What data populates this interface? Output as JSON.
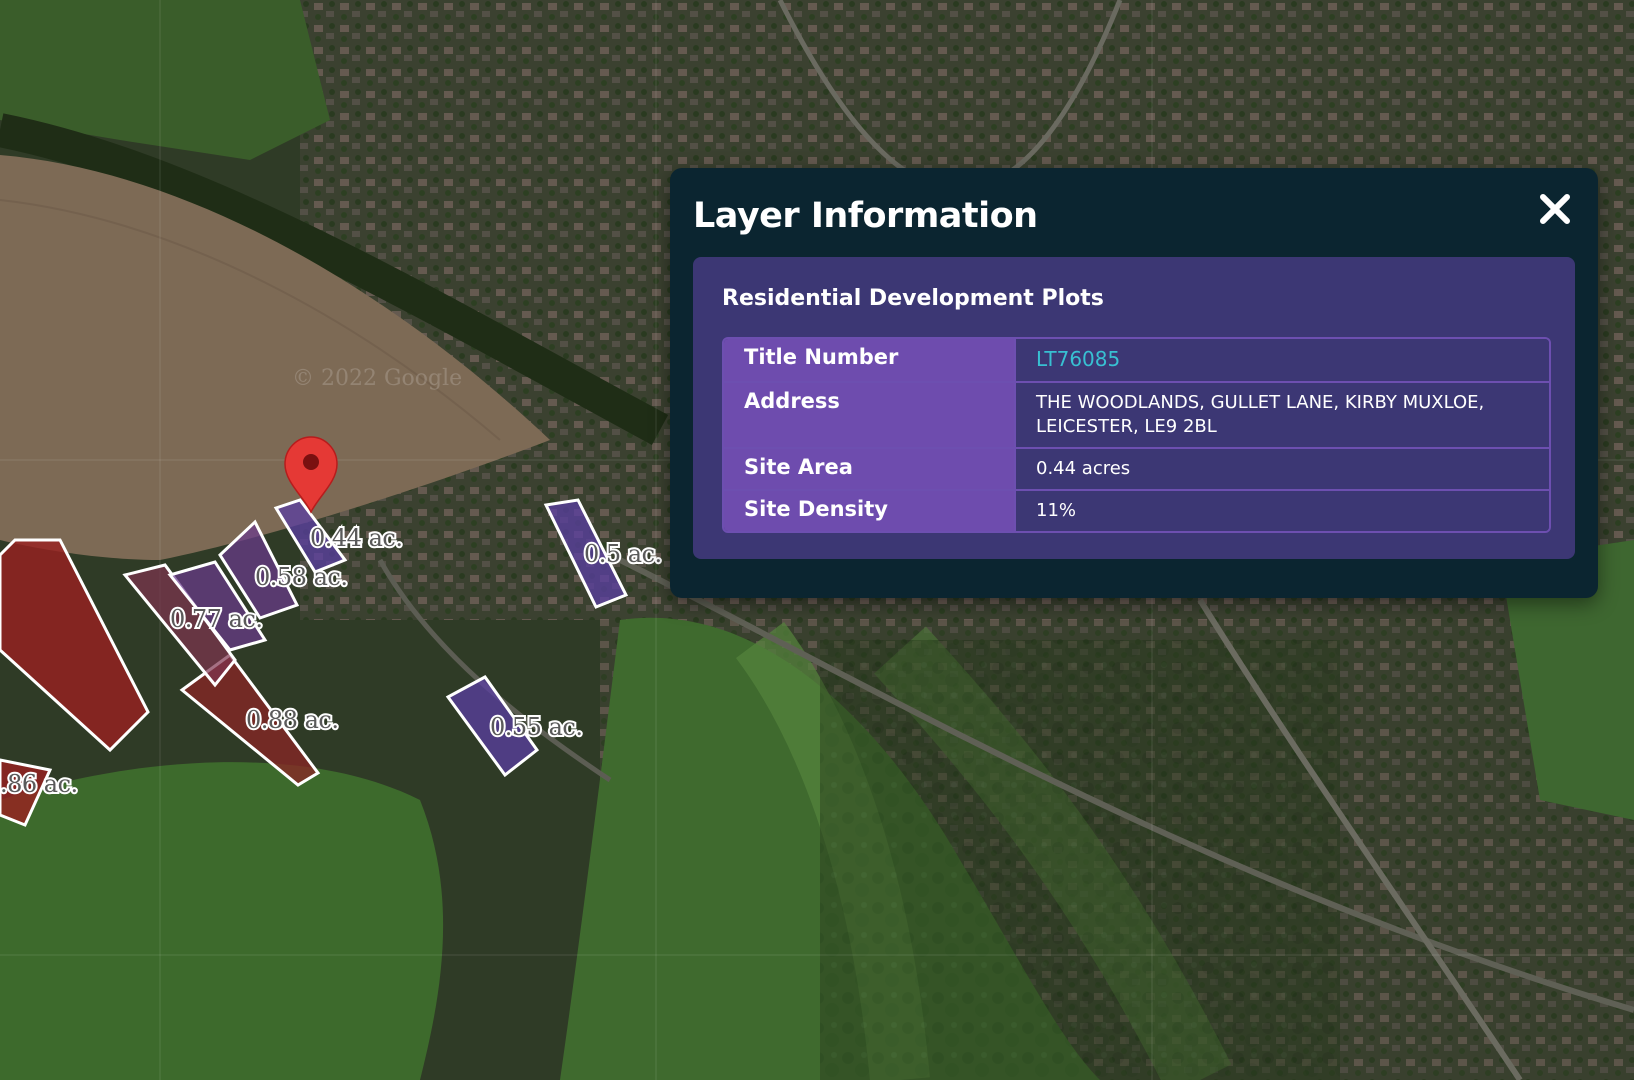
{
  "map": {
    "watermark": "© 2022 Google",
    "plots": [
      {
        "id": "p044",
        "label": "0.44 ac.",
        "color": "#5b3fa3"
      },
      {
        "id": "p058",
        "label": "0.58 ac.",
        "color": "#6b3a8e"
      },
      {
        "id": "p077",
        "label": "0.77 ac.",
        "color": "#7f3550"
      },
      {
        "id": "p088",
        "label": "0.88 ac.",
        "color": "#8b2626"
      },
      {
        "id": "p086",
        "label": ".86 ac.",
        "color": "#9a2020"
      },
      {
        "id": "p05",
        "label": "0.5 ac.",
        "color": "#5b3fa3"
      },
      {
        "id": "p055",
        "label": "0.55 ac.",
        "color": "#5b3fa3"
      }
    ],
    "marker_color": "#e53935"
  },
  "panel": {
    "title": "Layer Information",
    "close_icon": "close-icon",
    "layer_name": "Residential Development Plots",
    "rows": [
      {
        "key": "Title Number",
        "value": "LT76085",
        "is_link": true
      },
      {
        "key": "Address",
        "value": "THE WOODLANDS, GULLET LANE, KIRBY MUXLOE, LEICESTER, LE9 2BL"
      },
      {
        "key": "Site Area",
        "value": "0.44 acres"
      },
      {
        "key": "Site Density",
        "value": "11%"
      }
    ],
    "link_color": "#38c0d2"
  }
}
